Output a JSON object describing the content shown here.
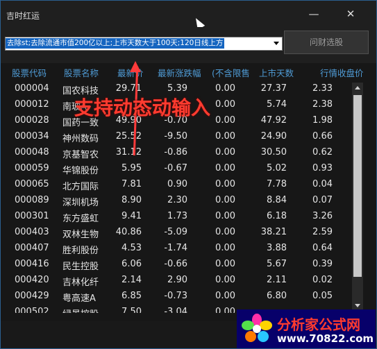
{
  "window": {
    "title": "吉时红运",
    "minimize_label": "—",
    "close_label": "✕"
  },
  "toolbar": {
    "query_text": "去除st;去除流通市值200亿以上;上市天数大于100天;120日线上方",
    "ask_button_label": "问财选股"
  },
  "table": {
    "columns": [
      "股票代码",
      "股票名称",
      "最新价",
      "最新涨跌幅",
      "(不含限售",
      "上市天数",
      "行情收盘价"
    ],
    "rows": [
      [
        "000004",
        "国农科技",
        "29.71",
        "5.39",
        "0.00",
        "27.37",
        "2.33"
      ],
      [
        "000012",
        "南玻A",
        "",
        "",
        "0.00",
        "5.74",
        "2.38"
      ],
      [
        "000028",
        "国药一致",
        "49.90",
        "-0.70",
        "0.00",
        "47.92",
        "1.98"
      ],
      [
        "000034",
        "神州数码",
        "25.52",
        "-9.50",
        "0.00",
        "24.90",
        "0.66"
      ],
      [
        "000048",
        "京基智农",
        "31.12",
        "-0.86",
        "0.00",
        "30.50",
        "0.62"
      ],
      [
        "000059",
        "华锦股份",
        "5.95",
        "-0.67",
        "0.00",
        "5.02",
        "0.93"
      ],
      [
        "000065",
        "北方国际",
        "7.81",
        "0.90",
        "0.00",
        "7.78",
        "0.04"
      ],
      [
        "000089",
        "深圳机场",
        "8.90",
        "2.30",
        "0.00",
        "8.84",
        "0.07"
      ],
      [
        "000301",
        "东方盛虹",
        "9.41",
        "1.73",
        "0.00",
        "6.18",
        "3.26"
      ],
      [
        "000403",
        "双林生物",
        "40.86",
        "-5.09",
        "0.00",
        "38.21",
        "2.59"
      ],
      [
        "000407",
        "胜利股份",
        "4.53",
        "-1.74",
        "0.00",
        "3.88",
        "0.64"
      ],
      [
        "000416",
        "民生控股",
        "6.06",
        "-0.66",
        "0.00",
        "5.67",
        "0.39"
      ],
      [
        "000420",
        "吉林化纤",
        "2.14",
        "2.90",
        "0.00",
        "2.11",
        "0.02"
      ],
      [
        "000429",
        "粤高速A",
        "6.85",
        "-0.73",
        "0.00",
        "6.80",
        "0.05"
      ],
      [
        "000502",
        "绿景控股",
        "7.50",
        "-3.04",
        "0.00",
        "",
        ""
      ]
    ]
  },
  "annotation": {
    "text": "支持动态动输入",
    "color": "#ff3b2f"
  },
  "watermark": {
    "title": "分析家公式网",
    "url": "www.70822.com"
  },
  "colors": {
    "header_text": "#4f9bd5",
    "background": "#171717",
    "selection": "#1565c0"
  }
}
